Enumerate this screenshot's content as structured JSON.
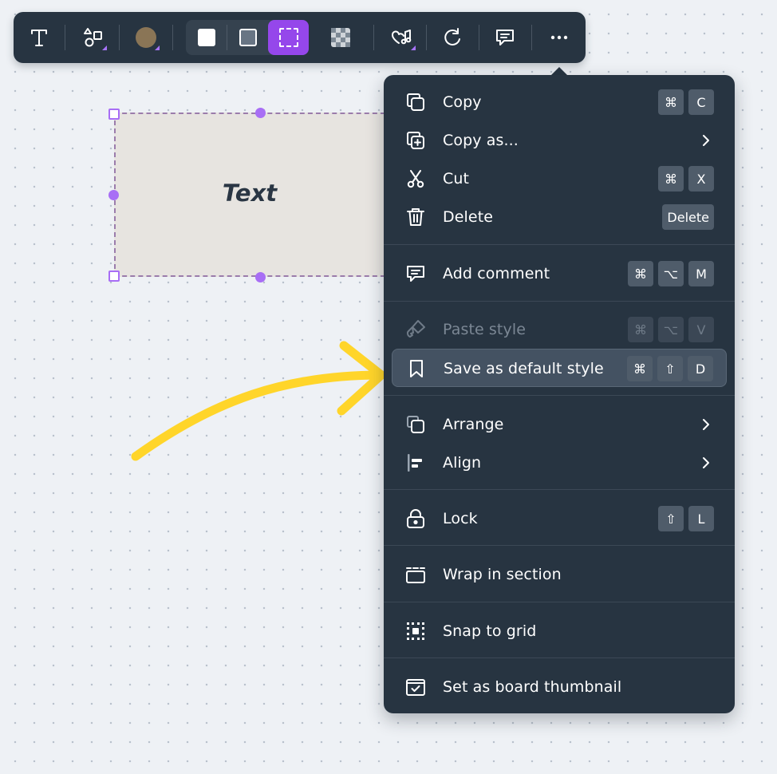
{
  "toolbar": {
    "items": [
      {
        "name": "text-tool",
        "icon": "text-icon"
      },
      {
        "name": "shapes-tool",
        "icon": "shapes-icon"
      },
      {
        "name": "color-picker",
        "icon": "color-swatch-icon",
        "color": "#8a7556"
      },
      {
        "name": "fill-solid",
        "icon": "fill-solid-icon"
      },
      {
        "name": "fill-outline",
        "icon": "fill-outline-icon"
      },
      {
        "name": "fill-dashed",
        "icon": "fill-dashed-icon",
        "active": true
      },
      {
        "name": "opacity",
        "icon": "checkerboard-icon"
      },
      {
        "name": "reactions",
        "icon": "heart-music-icon"
      },
      {
        "name": "redo",
        "icon": "rotate-icon"
      },
      {
        "name": "comment",
        "icon": "comment-icon"
      },
      {
        "name": "more",
        "icon": "more-icon"
      }
    ]
  },
  "canvas": {
    "shape_text": "Text",
    "shape_fill": "#e7e4e0",
    "selection_color": "#a86ef5",
    "arrow_color": "#ffd52a"
  },
  "menu": {
    "items": [
      {
        "label": "Copy",
        "icon": "copy-icon",
        "keys": [
          "⌘",
          "C"
        ]
      },
      {
        "label": "Copy as...",
        "icon": "copy-plus-icon",
        "submenu": true
      },
      {
        "label": "Cut",
        "icon": "scissors-icon",
        "keys": [
          "⌘",
          "X"
        ]
      },
      {
        "label": "Delete",
        "icon": "trash-icon",
        "keys": [
          "Delete"
        ]
      },
      {
        "label": "Add comment",
        "icon": "comment-icon",
        "keys": [
          "⌘",
          "⌥",
          "M"
        ]
      },
      {
        "label": "Paste style",
        "icon": "paintbrush-icon",
        "keys": [
          "⌘",
          "⌥",
          "V"
        ],
        "disabled": true
      },
      {
        "label": "Save as default style",
        "icon": "bookmark-icon",
        "keys": [
          "⌘",
          "⇧",
          "D"
        ],
        "highlighted": true
      },
      {
        "label": "Arrange",
        "icon": "arrange-icon",
        "submenu": true
      },
      {
        "label": "Align",
        "icon": "align-icon",
        "submenu": true
      },
      {
        "label": "Lock",
        "icon": "lock-icon",
        "keys": [
          "⇧",
          "L"
        ]
      },
      {
        "label": "Wrap in section",
        "icon": "section-icon"
      },
      {
        "label": "Snap to grid",
        "icon": "snap-grid-icon"
      },
      {
        "label": "Set as board thumbnail",
        "icon": "thumbnail-icon"
      }
    ]
  }
}
